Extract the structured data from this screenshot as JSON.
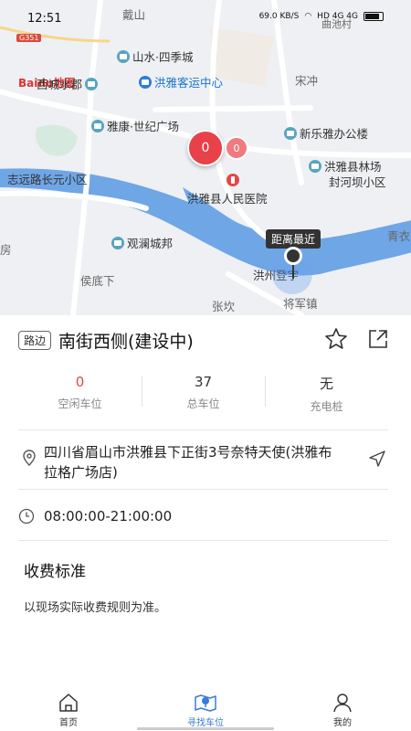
{
  "status_bar": {
    "time": "12:51",
    "net_speed": "69.0 KB/S",
    "network": "HD 4G 4G"
  },
  "map": {
    "road_tag": "G351",
    "logo": "Baidu地图",
    "labels": [
      {
        "text": "戴山",
        "style": "grey"
      },
      {
        "text": "山水·四季城",
        "style": "normal"
      },
      {
        "text": "西城水郡",
        "style": "normal"
      },
      {
        "text": "洪雅客运中心",
        "style": "blue"
      },
      {
        "text": "宋冲",
        "style": "grey"
      },
      {
        "text": "雅康·世纪广场",
        "style": "normal"
      },
      {
        "text": "新乐雅办公楼",
        "style": "normal"
      },
      {
        "text": "洪雅县林场",
        "style": "normal"
      },
      {
        "text": "封河坝小区",
        "style": "normal"
      },
      {
        "text": "志远路长元小区",
        "style": "normal"
      },
      {
        "text": "洪雅县人民医院",
        "style": "normal"
      },
      {
        "text": "观澜城邦",
        "style": "normal"
      },
      {
        "text": "侯底下",
        "style": "grey"
      },
      {
        "text": "张坎",
        "style": "grey"
      },
      {
        "text": "洪州登宇",
        "style": "normal"
      },
      {
        "text": "将军镇",
        "style": "grey"
      },
      {
        "text": "青衣",
        "style": "grey"
      },
      {
        "text": "房",
        "style": "grey"
      },
      {
        "text": "曲池村",
        "style": "grey"
      }
    ],
    "markers": {
      "big": "0",
      "small": "0"
    },
    "tooltip": "距离最近"
  },
  "parking": {
    "tag": "路边",
    "name": "南街西侧(建设中)",
    "stats": [
      {
        "value": "0",
        "label": "空闲车位",
        "color": "#e24848"
      },
      {
        "value": "37",
        "label": "总车位"
      },
      {
        "value": "无",
        "label": "充电桩"
      }
    ],
    "address": "四川省眉山市洪雅县下正街3号奈特天使(洪雅布拉格广场店)",
    "hours": "08:00:00-21:00:00",
    "fee_title": "收费标准",
    "fee_text": "以现场实际收费规则为准。"
  },
  "tabbar": {
    "tabs": [
      {
        "label": "首页",
        "icon": "home-icon",
        "active": false
      },
      {
        "label": "寻找车位",
        "icon": "map-search-icon",
        "active": true
      },
      {
        "label": "我的",
        "icon": "user-icon",
        "active": false
      }
    ]
  },
  "colors": {
    "accent": "#3a7bd5",
    "danger": "#e24848",
    "river": "#6fa6e6"
  }
}
